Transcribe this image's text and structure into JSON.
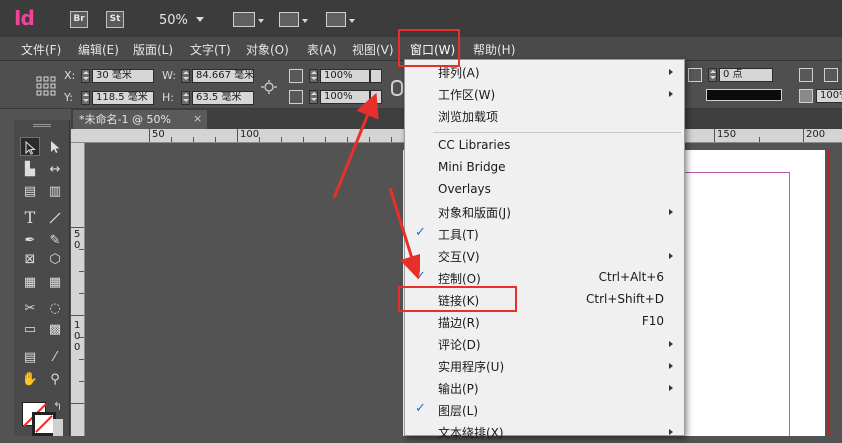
{
  "app": {
    "logo": "Id",
    "bridge_label": "Br",
    "stock_label": "St",
    "zoom": "50%"
  },
  "menubar": {
    "items": [
      "文件(F)",
      "编辑(E)",
      "版面(L)",
      "文字(T)",
      "对象(O)",
      "表(A)",
      "视图(V)",
      "窗口(W)",
      "帮助(H)"
    ]
  },
  "control": {
    "x_label": "X:",
    "y_label": "Y:",
    "w_label": "W:",
    "h_label": "H:",
    "x_value": "30 毫米",
    "y_value": "118.5 毫米",
    "w_value": "84.667 毫米",
    "h_value": "63.5 毫米",
    "scale_x": "100%",
    "scale_y": "100%",
    "stroke_weight": "0 点",
    "opacity": "100%"
  },
  "document": {
    "tab_title": "*未命名-1 @ 50%",
    "close_glyph": "×",
    "ruler_h": [
      "50",
      "100",
      "150",
      "200"
    ],
    "ruler_v": [
      "5",
      "0",
      "1",
      "0",
      "0"
    ]
  },
  "window_menu": {
    "items": [
      {
        "label": "排列(A)",
        "submenu": true
      },
      {
        "label": "工作区(W)",
        "submenu": true
      },
      {
        "label": "浏览加载项"
      },
      {
        "label": "CC Libraries"
      },
      {
        "label": "Mini Bridge"
      },
      {
        "label": "Overlays"
      },
      {
        "label": "对象和版面(J)",
        "submenu": true
      },
      {
        "label": "工具(T)",
        "checked": true
      },
      {
        "label": "交互(V)",
        "submenu": true
      },
      {
        "label": "控制(O)",
        "checked": true,
        "shortcut": "Ctrl+Alt+6"
      },
      {
        "label": "链接(K)",
        "shortcut": "Ctrl+Shift+D"
      },
      {
        "label": "描边(R)",
        "shortcut": "F10"
      },
      {
        "label": "评论(D)",
        "submenu": true
      },
      {
        "label": "实用程序(U)",
        "submenu": true
      },
      {
        "label": "输出(P)",
        "submenu": true
      },
      {
        "label": "图层(L)",
        "checked": true
      },
      {
        "label": "文本绕排(X)",
        "submenu": true
      }
    ]
  },
  "colors": {
    "accent": "#f0449b",
    "highlight": "#e8302b",
    "check": "#2d6bd6"
  }
}
